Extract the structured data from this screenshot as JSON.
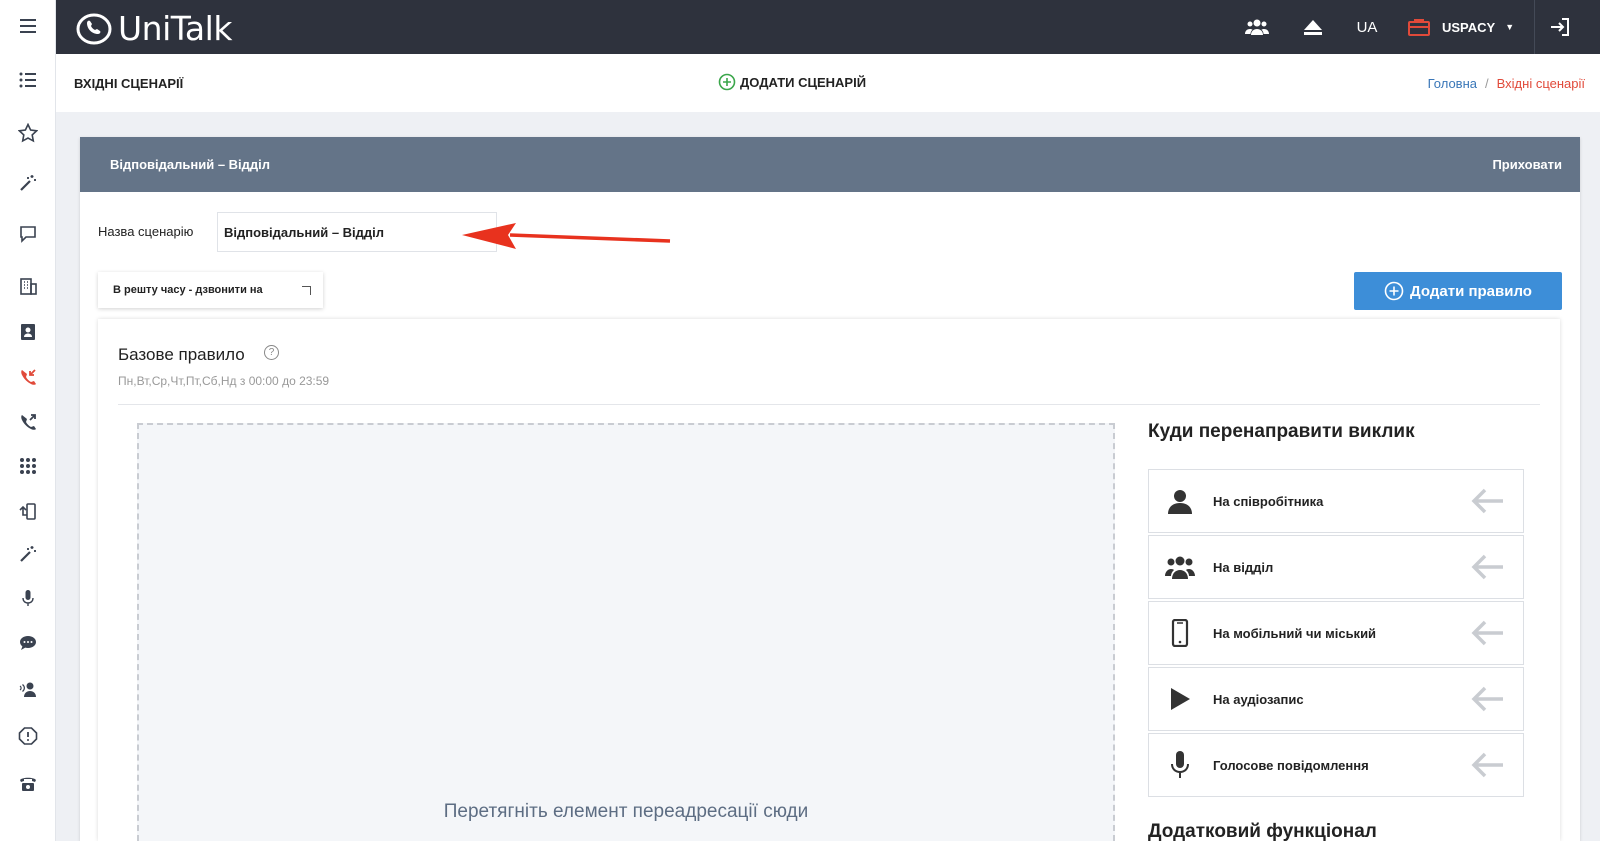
{
  "app": {
    "logo_text": "UniTalk"
  },
  "topbar": {
    "lang": "UA",
    "company": "USPACY",
    "icons": [
      "users-icon",
      "eject-icon",
      "briefcase-icon",
      "logout-icon"
    ]
  },
  "sidebar": {
    "icons": [
      "menu-icon",
      "list-icon",
      "star-icon",
      "magic-wand-icon",
      "chat-icon",
      "building-icon",
      "contacts-icon",
      "incoming-call-icon",
      "outgoing-call-icon",
      "grid-icon",
      "phone-transfer-icon",
      "magic-wand-icon",
      "microphone-icon",
      "comments-icon",
      "user-voice-icon",
      "alert-icon",
      "telephone-icon"
    ],
    "active_color": "#e14a3a"
  },
  "header": {
    "title": "ВХІДНІ СЦЕНАРІЇ",
    "add_scenario": "ДОДАТИ СЦЕНАРІЙ",
    "breadcrumb": {
      "home": "Головна",
      "separator": "/",
      "current": "Вхідні сценарії"
    }
  },
  "card": {
    "title": "Відповідальний – Відділ",
    "hide_label": "Приховати",
    "name_label": "Назва сценарію",
    "name_value": "Відповідальний – Відділ",
    "rest_time_label": "В решту часу - дзвонити на",
    "add_rule_label": "Додати правило"
  },
  "rule": {
    "title": "Базове правило",
    "help": "?",
    "schedule": "Пн,Вт,Ср,Чт,Пт,Сб,Нд з 00:00 до 23:59",
    "dropzone_text": "Перетягніть елемент переадресації сюди"
  },
  "redirect": {
    "title": "Куди перенаправити виклик",
    "options": [
      {
        "label": "На співробітника",
        "icon": "user-icon"
      },
      {
        "label": "На відділ",
        "icon": "users-icon"
      },
      {
        "label": "На мобільний чи міський",
        "icon": "mobile-icon"
      },
      {
        "label": "На аудіозапис",
        "icon": "play-icon"
      },
      {
        "label": "Голосове повідомлення",
        "icon": "microphone-icon"
      }
    ],
    "extra_title": "Додатковий функціонал"
  },
  "colors": {
    "topbar": "#2e323d",
    "card_header": "#647488",
    "primary": "#3d8ed8",
    "accent": "#e14a3a",
    "green": "#3aa64a"
  }
}
